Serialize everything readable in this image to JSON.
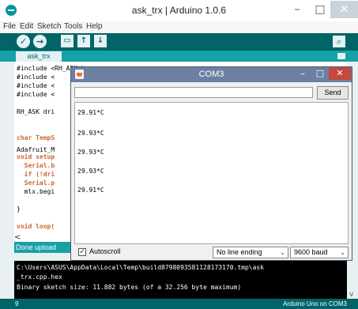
{
  "ide": {
    "title": "ask_trx | Arduino 1.0.6",
    "window_controls": {
      "minimize": "–",
      "maximize": "□",
      "close": "✕"
    },
    "menu": [
      "File",
      "Edit",
      "Sketch",
      "Tools",
      "Help"
    ],
    "toolbar": {
      "verify_glyph": "✓",
      "upload_glyph": "→",
      "new_glyph": "▭",
      "open_glyph": "↑",
      "save_glyph": "↓",
      "search_glyph": "⌕"
    },
    "tab_label": "ask_trx",
    "code_lines": [
      "#include <RH_ASK.h>",
      "#include <",
      "#include <",
      "#include <",
      "RH_ASK dri",
      "Adafruit_M",
      "char TempS",
      "void setup",
      "  Serial.b",
      "  if (!dri",
      "  Serial.p",
      "  mlx.begi",
      "}",
      "void loop("
    ],
    "scroll_left_glyph": "<",
    "status_text": "Done upload",
    "console_lines": [
      "C:\\Users\\ASUS\\AppData\\Local\\Temp\\build8798093581128173170.tmp\\ask",
      "_trx.cpp.hex",
      "Binary sketch size: 11.882 bytes (of a 32.256 byte maximum)"
    ],
    "console_scroll_glyph": "v",
    "line_number": "9",
    "board": "Arduino Uno on COM3",
    "colors": {
      "toolbar": "#006468",
      "tabbar": "#17a1a5",
      "keyword": "#cc6633"
    }
  },
  "serial": {
    "title": "COM3",
    "window_controls": {
      "minimize": "–",
      "maximize": "□",
      "close": "✕"
    },
    "input_value": "",
    "send_label": "Send",
    "output_lines": [
      "29.91*C",
      "29.93*C",
      "29.93*C",
      "29.93*C",
      "29.91*C"
    ],
    "autoscroll_label": "Autoscroll",
    "autoscroll_checked_glyph": "✓",
    "line_ending": "No line ending",
    "baud": "9600 baud",
    "dropdown_glyph": "⌄",
    "colors": {
      "titlebar": "#6d80a3",
      "close": "#c7483d"
    }
  }
}
